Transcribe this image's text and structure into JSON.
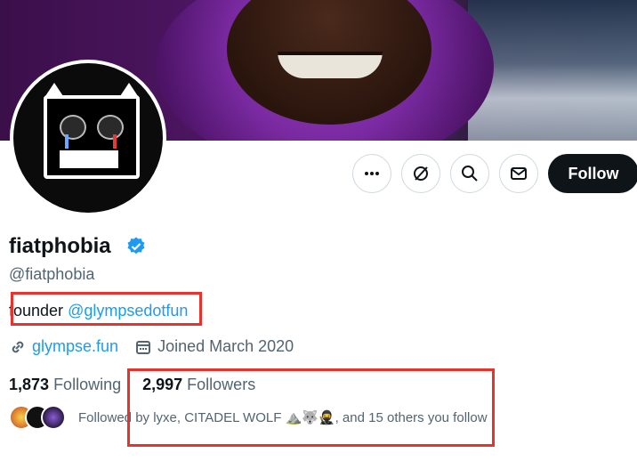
{
  "profile": {
    "name": "fiatphobia",
    "handle": "@fiatphobia",
    "bio_prefix": "founder",
    "bio_mention": "@glympsedotfun",
    "website": "glympse.fun",
    "joined": "Joined March 2020"
  },
  "actions": {
    "more_icon": "more-icon",
    "grok_icon": "grok-icon",
    "search_icon": "search-icon",
    "message_icon": "mail-icon",
    "follow_label": "Follow"
  },
  "stats": {
    "following_count": "1,873",
    "following_label": "Following",
    "followers_count": "2,997",
    "followers_label": "Followers"
  },
  "followed_by": "Followed by lyxe, CITADEL WOLF ⛰️🐺🥷, and 15 others you follow",
  "colors": {
    "accent": "#1d9bf0",
    "highlight": "#e8322d",
    "follow_bg": "#0f1419"
  }
}
